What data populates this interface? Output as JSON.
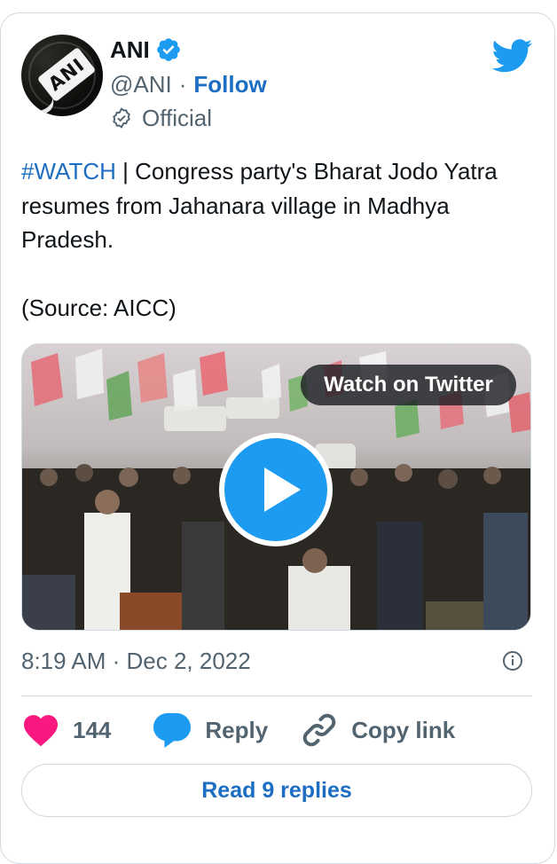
{
  "author": {
    "name": "ANI",
    "handle": "@ANI",
    "separator": "·",
    "follow_label": "Follow",
    "label": "Official",
    "avatar_text": "ANI",
    "verified_icon": "verified-badge-icon",
    "brand_icon": "twitter-bird-icon"
  },
  "tweet": {
    "hashtag": "#WATCH",
    "text": " | Congress party's Bharat Jodo Yatra resumes from Jahanara village in Madhya Pradesh.",
    "source": "(Source: AICC)"
  },
  "media": {
    "overlay_label": "Watch on Twitter",
    "play_icon": "play-icon"
  },
  "meta": {
    "timestamp": "8:19 AM · Dec 2, 2022",
    "info_icon": "info-icon"
  },
  "actions": {
    "likes": "144",
    "reply_label": "Reply",
    "copy_link_label": "Copy link"
  },
  "footer": {
    "read_replies_label": "Read 9 replies"
  },
  "colors": {
    "accent": "#1d9bf0",
    "link": "#1d6ec2",
    "like": "#f91880",
    "muted": "#536471",
    "border": "#cfd9de"
  }
}
